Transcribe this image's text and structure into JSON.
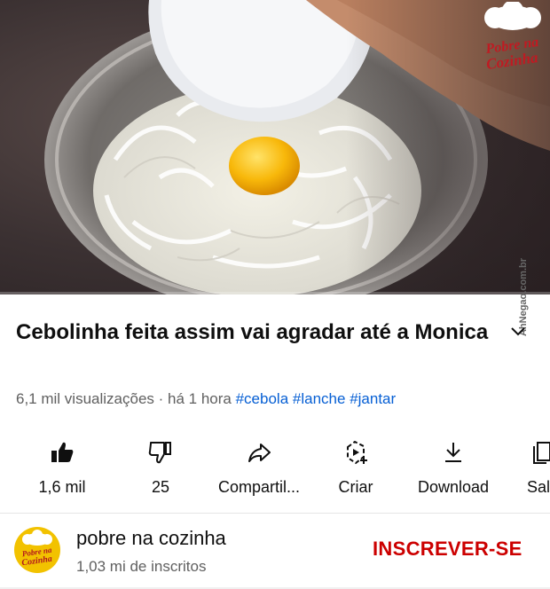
{
  "video": {
    "watermark_logo_text": "Pobre na Cozinha",
    "side_watermark": "AhNegao.com.br",
    "progress_fraction": 0.0
  },
  "title": "Cebolinha feita assim vai agradar até a Monica",
  "meta": {
    "views": "6,1 mil visualizações",
    "separator": " · ",
    "time": "há 1 hora",
    "tags": [
      "#cebola",
      "#lanche",
      "#jantar"
    ]
  },
  "actions": [
    {
      "icon": "thumbs-up-icon",
      "label": "1,6 mil"
    },
    {
      "icon": "thumbs-down-icon",
      "label": "25"
    },
    {
      "icon": "share-icon",
      "label": "Compartil..."
    },
    {
      "icon": "create-icon",
      "label": "Criar"
    },
    {
      "icon": "download-icon",
      "label": "Download"
    },
    {
      "icon": "save-icon",
      "label": "Sal"
    }
  ],
  "channel": {
    "name": "pobre na cozinha",
    "subscribers": "1,03 mi de inscritos",
    "subscribe_label": "INSCREVER-SE",
    "avatar_text": "Pobre na Cozinha"
  },
  "colors": {
    "link": "#065fd4",
    "subscribe": "#cc0000",
    "brand_red": "#b2161e",
    "avatar_bg": "#f2c200"
  }
}
